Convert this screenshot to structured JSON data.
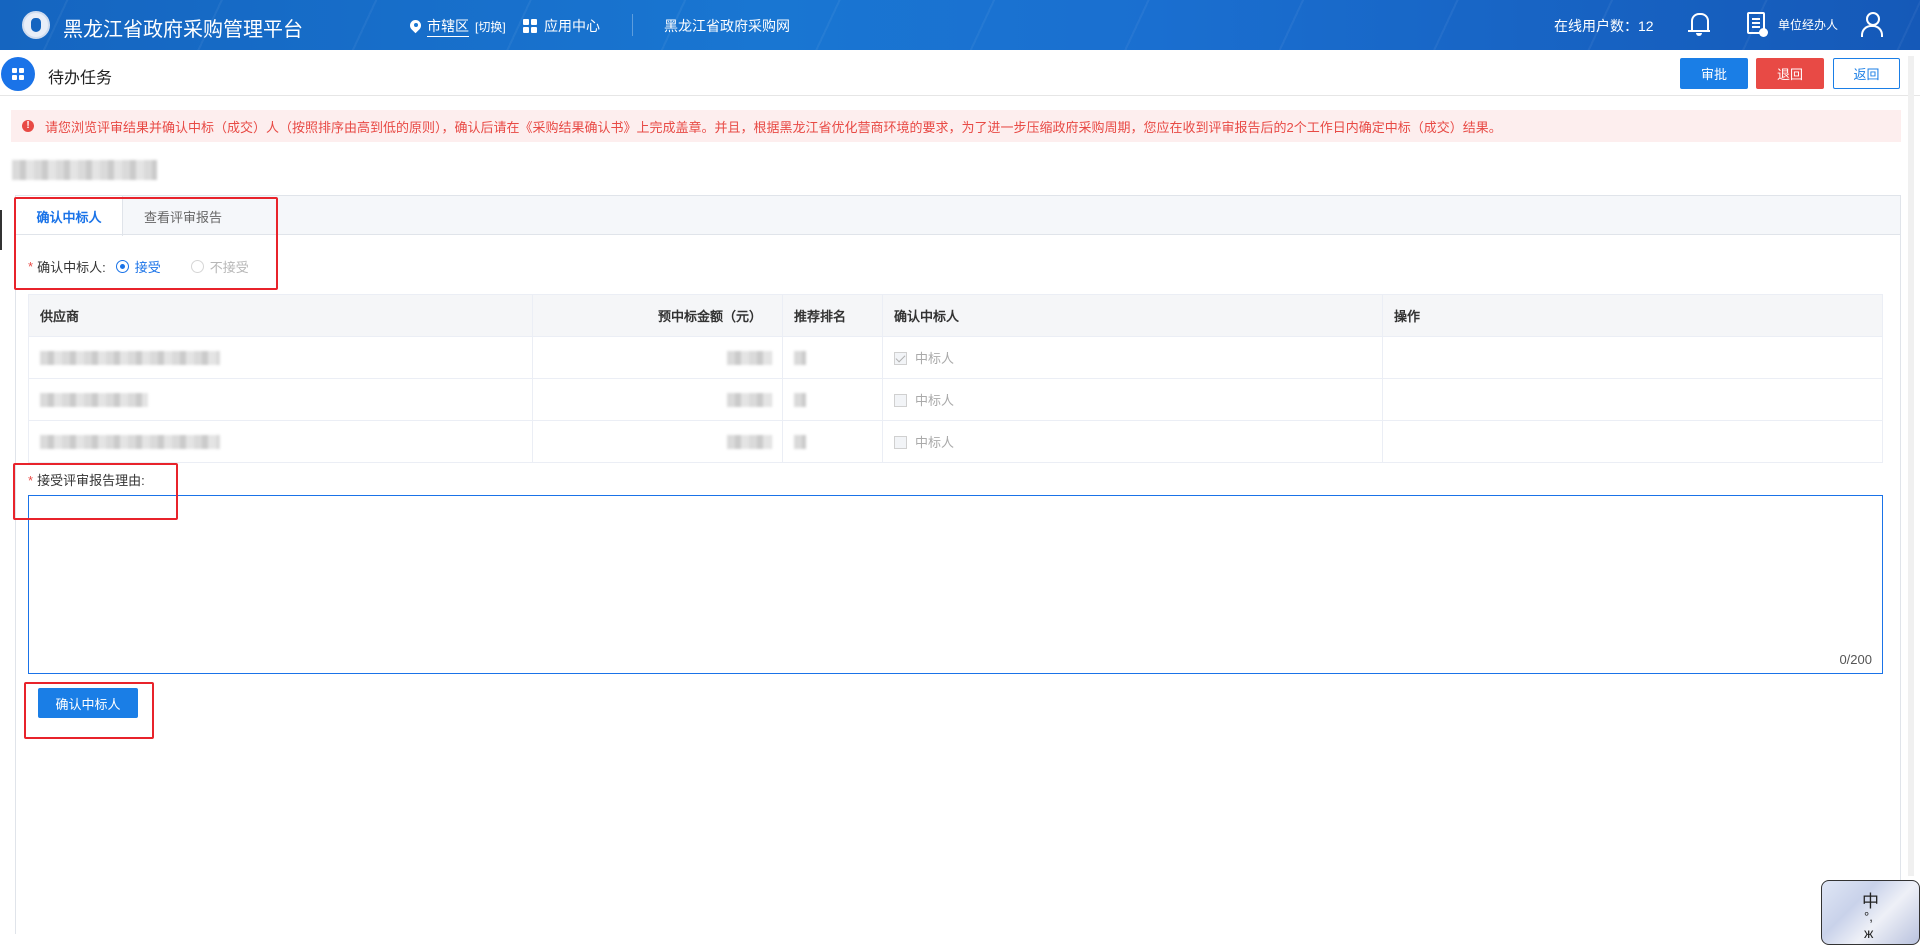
{
  "header": {
    "app_title": "黑龙江省政府采购管理平台",
    "region": "市辖区",
    "region_switch": "[切换]",
    "app_center": "应用中心",
    "site_link": "黑龙江省政府采购网",
    "online_label": "在线用户数：",
    "online_count": "12",
    "role": "单位经办人",
    "icons": [
      "logo-icon",
      "location-pin-icon",
      "grid-icon",
      "bell-icon",
      "document-icon",
      "user-icon"
    ]
  },
  "page": {
    "title": "待办任务",
    "buttons": {
      "approve": "审批",
      "reject": "退回",
      "back": "返回"
    }
  },
  "alert": {
    "text": "请您浏览评审结果并确认中标（成交）人（按照排序由高到低的原则），确认后请在《采购结果确认书》上完成盖章。并且，根据黑龙江省优化营商环境的要求，为了进一步压缩政府采购周期，您应在收到评审报告后的2个工作日内确定中标（成交）结果。",
    "color": "#e84a45"
  },
  "tabs": [
    {
      "label": "确认中标人",
      "active": true
    },
    {
      "label": "查看评审报告",
      "active": false
    }
  ],
  "confirm": {
    "label": "确认中标人:",
    "options": {
      "accept": "接受",
      "reject": "不接受"
    },
    "selected": "接受"
  },
  "table": {
    "columns": [
      "供应商",
      "预中标金额（元）",
      "推荐排名",
      "确认中标人",
      "操作"
    ],
    "rows": [
      {
        "winner_label": "中标人",
        "checked": true
      },
      {
        "winner_label": "中标人",
        "checked": false
      },
      {
        "winner_label": "中标人",
        "checked": false
      }
    ]
  },
  "reason": {
    "label": "接受评审报告理由:",
    "value": "",
    "counter": "0/200"
  },
  "submit_label": "确认中标人",
  "widget": {
    "char": "中",
    "sub": "°,",
    "glyph": "ж"
  },
  "colors": {
    "primary": "#1a7ee6",
    "danger": "#e84a45",
    "topbar": "#1976d2",
    "highlight": "#e8232b"
  }
}
